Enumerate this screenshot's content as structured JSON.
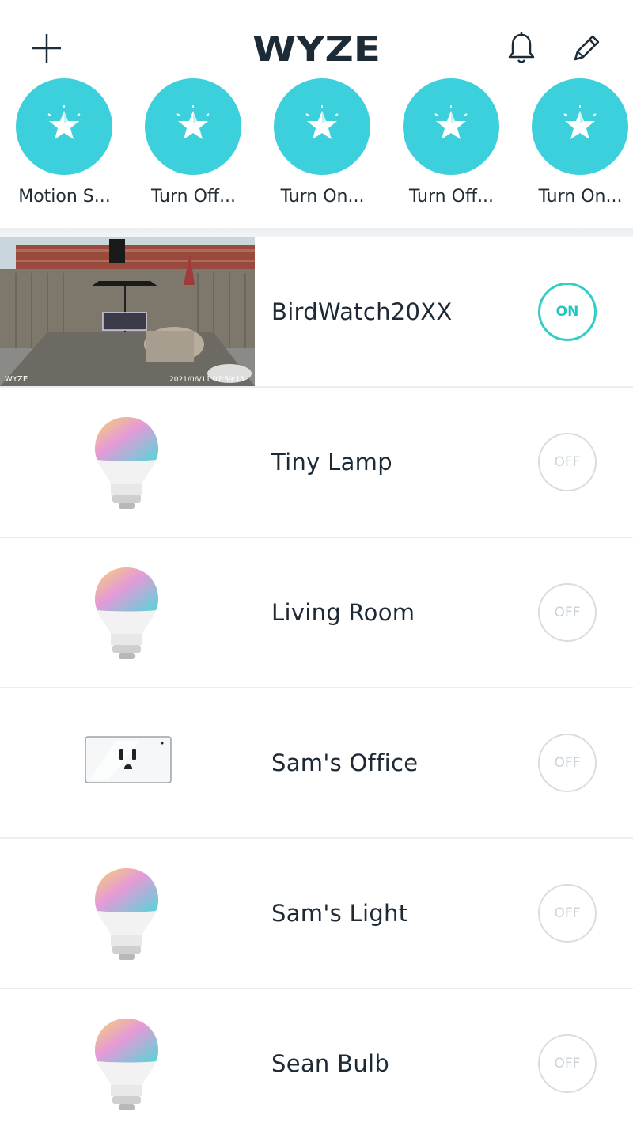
{
  "header": {
    "logo_text": "WYZE",
    "add_icon": "plus-icon",
    "bell_icon": "bell-icon",
    "edit_icon": "pencil-icon"
  },
  "shortcuts": [
    {
      "label": "Motion S...",
      "icon": "star-icon"
    },
    {
      "label": "Turn Off...",
      "icon": "star-icon"
    },
    {
      "label": "Turn On...",
      "icon": "star-icon"
    },
    {
      "label": "Turn Off...",
      "icon": "star-icon"
    },
    {
      "label": "Turn On...",
      "icon": "star-icon"
    }
  ],
  "devices": [
    {
      "name": "BirdWatch20XX",
      "type": "camera",
      "state": "ON",
      "overlay_brand": "WYZE",
      "overlay_timestamp": "2021/06/11 07:59:15"
    },
    {
      "name": "Tiny Lamp",
      "type": "bulb",
      "state": "OFF"
    },
    {
      "name": "Living Room",
      "type": "bulb",
      "state": "OFF"
    },
    {
      "name": "Sam's Office",
      "type": "plug",
      "state": "OFF"
    },
    {
      "name": "Sam's Light",
      "type": "bulb",
      "state": "OFF"
    },
    {
      "name": "Sean Bulb",
      "type": "bulb",
      "state": "OFF"
    }
  ],
  "colors": {
    "accent": "#3ccfdc",
    "on": "#2fcfc6",
    "off": "#d6dee3"
  }
}
